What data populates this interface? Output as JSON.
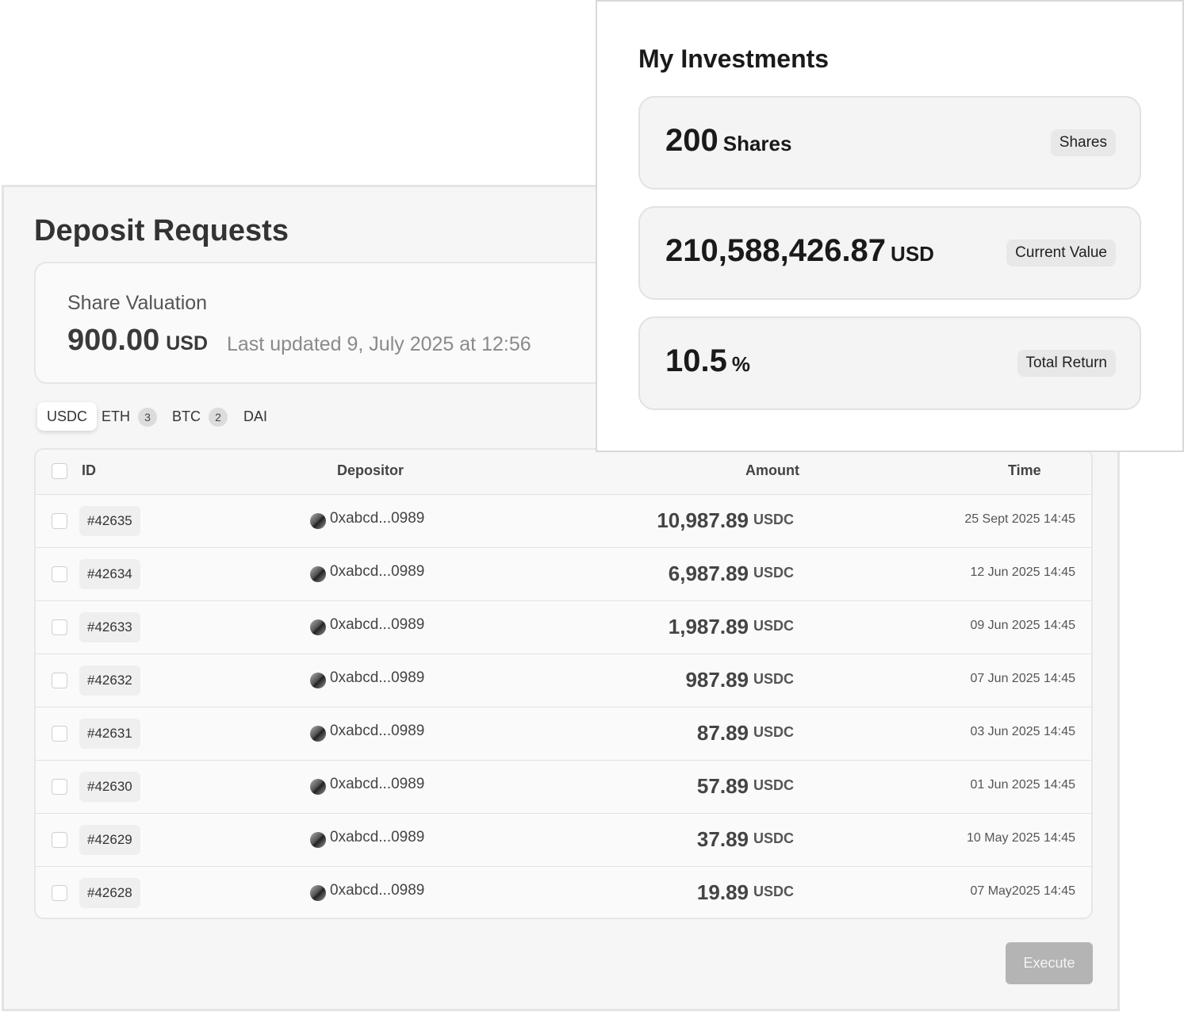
{
  "deposit": {
    "title": "Deposit Requests",
    "valuation": {
      "label": "Share Valuation",
      "value": "900.00",
      "unit": "USD",
      "updated": "Last updated 9, July 2025 at 12:56"
    },
    "tabs": [
      {
        "label": "USDC",
        "badge": ""
      },
      {
        "label": "ETH",
        "badge": "3"
      },
      {
        "label": "BTC",
        "badge": "2"
      },
      {
        "label": "DAI",
        "badge": ""
      }
    ],
    "table": {
      "headers": {
        "id": "ID",
        "depositor": "Depositor",
        "amount": "Amount",
        "time": "Time"
      },
      "rows": [
        {
          "id": "#42635",
          "depositor": "0xabcd...0989",
          "amount": "10,987.89",
          "unit": "USDC",
          "time": "25 Sept 2025 14:45"
        },
        {
          "id": "#42634",
          "depositor": "0xabcd...0989",
          "amount": "6,987.89",
          "unit": "USDC",
          "time": "12 Jun 2025 14:45"
        },
        {
          "id": "#42633",
          "depositor": "0xabcd...0989",
          "amount": "1,987.89",
          "unit": "USDC",
          "time": "09 Jun 2025 14:45"
        },
        {
          "id": "#42632",
          "depositor": "0xabcd...0989",
          "amount": "987.89",
          "unit": "USDC",
          "time": "07 Jun 2025 14:45"
        },
        {
          "id": "#42631",
          "depositor": "0xabcd...0989",
          "amount": "87.89",
          "unit": "USDC",
          "time": "03 Jun 2025 14:45"
        },
        {
          "id": "#42630",
          "depositor": "0xabcd...0989",
          "amount": "57.89",
          "unit": "USDC",
          "time": "01 Jun 2025 14:45"
        },
        {
          "id": "#42629",
          "depositor": "0xabcd...0989",
          "amount": "37.89",
          "unit": "USDC",
          "time": "10 May 2025 14:45"
        },
        {
          "id": "#42628",
          "depositor": "0xabcd...0989",
          "amount": "19.89",
          "unit": "USDC",
          "time": "07 May2025 14:45"
        }
      ]
    },
    "execute_label": "Execute"
  },
  "investments": {
    "title": "My Investments",
    "cards": [
      {
        "value": "200",
        "unit": "Shares",
        "tag": "Shares"
      },
      {
        "value": "210,588,426.87",
        "unit": "USD",
        "tag": "Current Value"
      },
      {
        "value": "10.5",
        "unit": "%",
        "tag": "Total Return"
      }
    ]
  }
}
